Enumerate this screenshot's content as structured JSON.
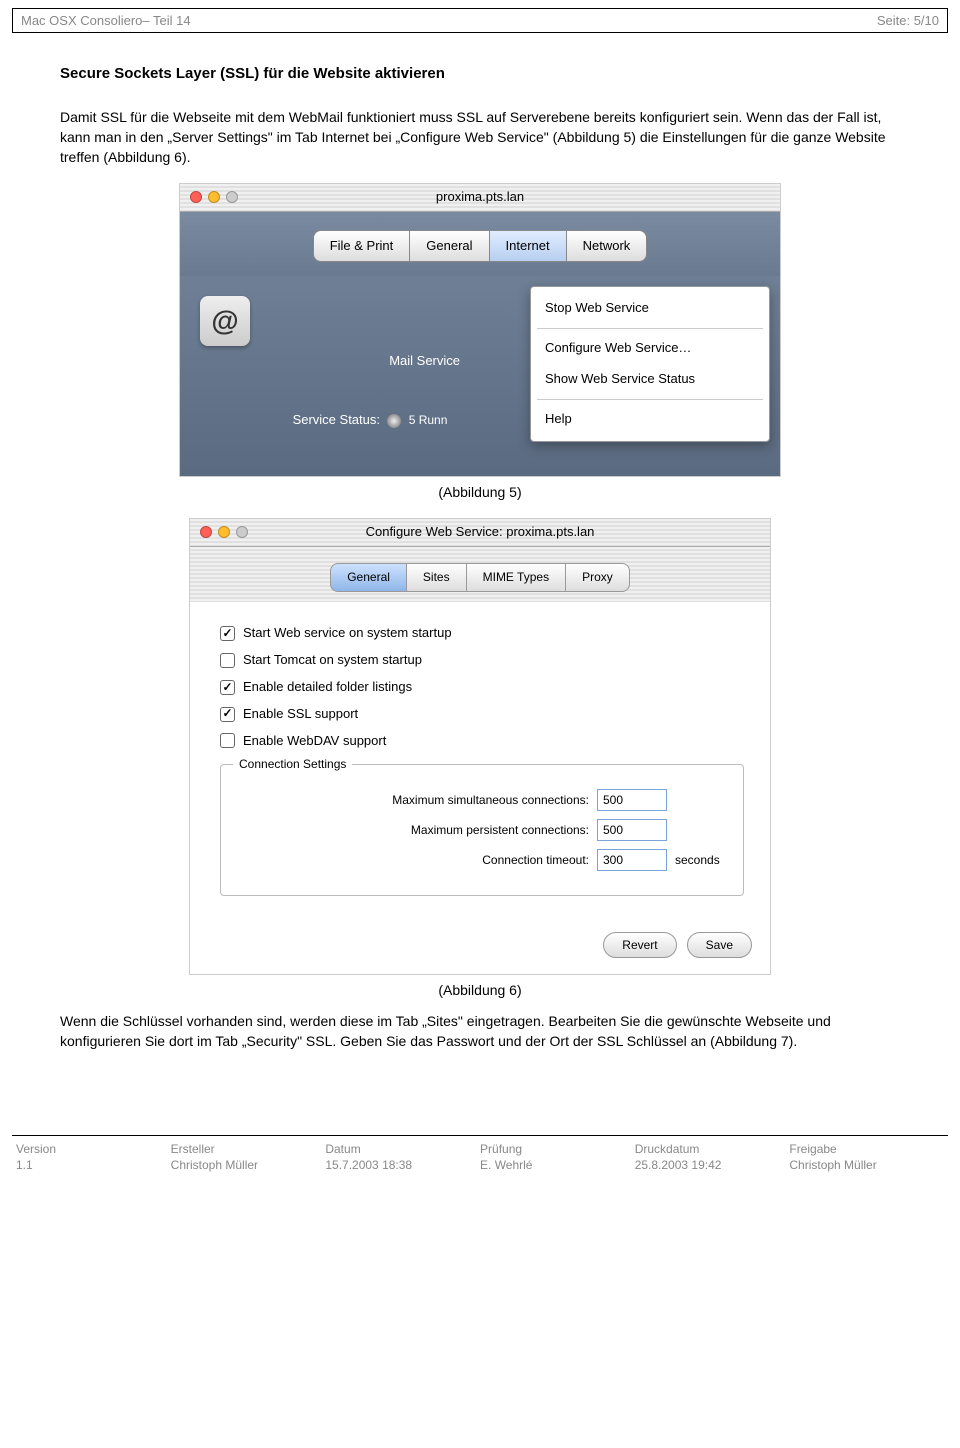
{
  "header": {
    "left": "Mac OSX Consoliero– Teil 14",
    "right": "Seite: 5/10"
  },
  "section_title": "Secure Sockets Layer (SSL) für die Website aktivieren",
  "para1": "Damit SSL für die Webseite mit dem WebMail funktioniert muss SSL auf Serverebene bereits konfiguriert sein. Wenn das der Fall ist, kann man in den „Server Settings\" im Tab Internet bei „Configure Web Service\" (Abbildung 5) die Einstellungen für die ganze Website treffen (Abbildung 6).",
  "shot5": {
    "title": "proxima.pts.lan",
    "tabs": [
      "File & Print",
      "General",
      "Internet",
      "Network"
    ],
    "mail_label": "Mail Service",
    "status_prefix": "Service Status:",
    "status_text": "5 Runn",
    "menu": [
      "Stop Web Service",
      "Configure Web Service…",
      "Show Web Service Status",
      "Help"
    ]
  },
  "caption5": "(Abbildung 5)",
  "shot6": {
    "title": "Configure Web Service: proxima.pts.lan",
    "tabs": [
      "General",
      "Sites",
      "MIME Types",
      "Proxy"
    ],
    "checks": [
      {
        "label": "Start Web service on system startup",
        "checked": true
      },
      {
        "label": "Start Tomcat on system startup",
        "checked": false
      },
      {
        "label": "Enable detailed folder listings",
        "checked": true
      },
      {
        "label": "Enable SSL support",
        "checked": true
      },
      {
        "label": "Enable WebDAV support",
        "checked": false
      }
    ],
    "fieldset_legend": "Connection Settings",
    "rows": [
      {
        "label": "Maximum simultaneous connections:",
        "value": "500",
        "unit": ""
      },
      {
        "label": "Maximum persistent connections:",
        "value": "500",
        "unit": ""
      },
      {
        "label": "Connection timeout:",
        "value": "300",
        "unit": "seconds"
      }
    ],
    "buttons": {
      "revert": "Revert",
      "save": "Save"
    }
  },
  "caption6": "(Abbildung 6)",
  "para2": "Wenn die Schlüssel vorhanden sind, werden diese im Tab „Sites\" eingetragen. Bearbeiten Sie die gewünschte Webseite und konfigurieren Sie dort  im Tab „Security\" SSL. Geben Sie das Passwort und der Ort der SSL Schlüssel an (Abbildung 7).",
  "footer": {
    "cols": [
      {
        "h": "Version",
        "v": "1.1"
      },
      {
        "h": "Ersteller",
        "v": "Christoph Müller"
      },
      {
        "h": "Datum",
        "v": "15.7.2003 18:38"
      },
      {
        "h": "Prüfung",
        "v": "E. Wehrlé"
      },
      {
        "h": "Druckdatum",
        "v": "25.8.2003 19:42"
      },
      {
        "h": "Freigabe",
        "v": "Christoph Müller"
      }
    ]
  }
}
